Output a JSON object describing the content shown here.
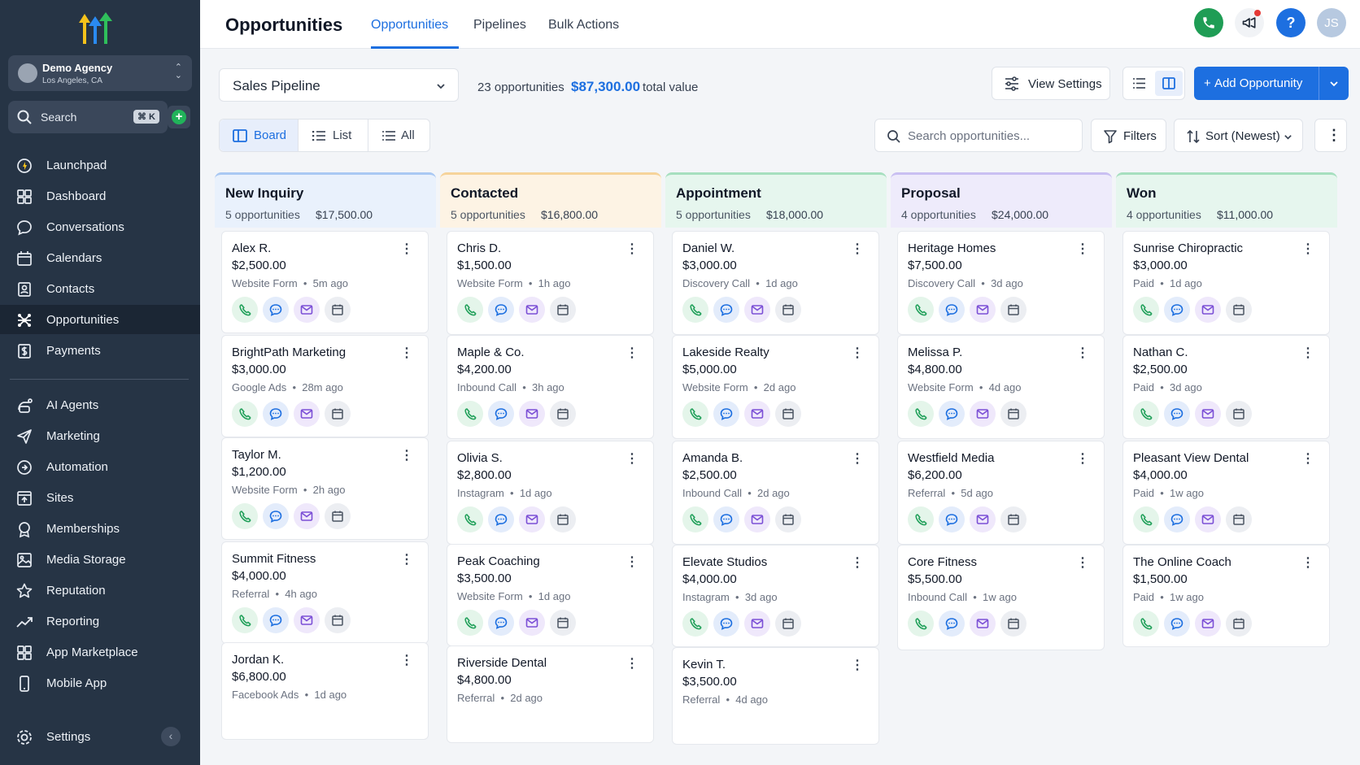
{
  "sidebar": {
    "account": {
      "name": "Demo Agency",
      "location": "Los Angeles, CA"
    },
    "search": {
      "label": "Search",
      "shortcut": "⌘ K"
    },
    "items": [
      {
        "label": "Launchpad",
        "icon": "launchpad-icon"
      },
      {
        "label": "Dashboard",
        "icon": "dashboard-icon"
      },
      {
        "label": "Conversations",
        "icon": "chat-icon"
      },
      {
        "label": "Calendars",
        "icon": "calendar-icon"
      },
      {
        "label": "Contacts",
        "icon": "contacts-icon"
      },
      {
        "label": "Opportunities",
        "icon": "opportunities-icon",
        "active": true
      },
      {
        "label": "Payments",
        "icon": "payments-icon"
      },
      {
        "label": "AI Agents",
        "icon": "ai-agents-icon"
      },
      {
        "label": "Marketing",
        "icon": "send-icon"
      },
      {
        "label": "Automation",
        "icon": "automation-icon"
      },
      {
        "label": "Sites",
        "icon": "sites-icon"
      },
      {
        "label": "Memberships",
        "icon": "memberships-icon"
      },
      {
        "label": "Media Storage",
        "icon": "media-icon"
      },
      {
        "label": "Reputation",
        "icon": "star-icon"
      },
      {
        "label": "Reporting",
        "icon": "trend-icon"
      },
      {
        "label": "App Marketplace",
        "icon": "apps-icon"
      },
      {
        "label": "Mobile App",
        "icon": "mobile-icon"
      }
    ],
    "settings": "Settings"
  },
  "header": {
    "title": "Opportunities",
    "tabs": [
      "Opportunities",
      "Pipelines",
      "Bulk Actions"
    ],
    "user_initials": "JS"
  },
  "toolbar": {
    "pipeline": "Sales Pipeline",
    "count": "23 opportunities",
    "total": "$87,300.00",
    "total_label": "total value",
    "view_settings": "View Settings",
    "add_opportunity": "Add Opportunity",
    "views": [
      "Board",
      "List",
      "All"
    ],
    "search_placeholder": "Search opportunities...",
    "filters": "Filters",
    "sort": "Sort (Newest)"
  },
  "colors": {
    "accent": "#1d6fe0",
    "sidebar": "#263445",
    "green": "#21a05a"
  },
  "columns": [
    {
      "title": "New Inquiry",
      "count": "5 opportunities",
      "value": "$17,500.00",
      "bg": "#e9f1fc",
      "bar": "#a9c8f3",
      "cards": [
        {
          "name": "Alex R.",
          "amount": "$2,500.00",
          "source": "Website Form",
          "time": "5m ago"
        },
        {
          "name": "BrightPath Marketing",
          "amount": "$3,000.00",
          "source": "Google Ads",
          "time": "28m ago"
        },
        {
          "name": "Taylor M.",
          "amount": "$1,200.00",
          "source": "Website Form",
          "time": "2h ago"
        },
        {
          "name": "Summit Fitness",
          "amount": "$4,000.00",
          "source": "Referral",
          "time": "4h ago"
        },
        {
          "name": "Jordan K.",
          "amount": "$6,800.00",
          "source": "Facebook Ads",
          "time": "1d ago"
        }
      ]
    },
    {
      "title": "Contacted",
      "count": "5 opportunities",
      "value": "$16,800.00",
      "bg": "#fdf3e4",
      "bar": "#f6d39a",
      "cards": [
        {
          "name": "Chris D.",
          "amount": "$1,500.00",
          "source": "Website Form",
          "time": "1h ago"
        },
        {
          "name": "Maple & Co.",
          "amount": "$4,200.00",
          "source": "Inbound Call",
          "time": "3h ago"
        },
        {
          "name": "Olivia S.",
          "amount": "$2,800.00",
          "source": "Instagram",
          "time": "1d ago"
        },
        {
          "name": "Peak Coaching",
          "amount": "$3,500.00",
          "source": "Website Form",
          "time": "1d ago"
        },
        {
          "name": "Riverside Dental",
          "amount": "$4,800.00",
          "source": "Referral",
          "time": "2d ago"
        }
      ]
    },
    {
      "title": "Appointment",
      "count": "5 opportunities",
      "value": "$18,000.00",
      "bg": "#e6f6ee",
      "bar": "#a6dfbf",
      "cards": [
        {
          "name": "Daniel W.",
          "amount": "$3,000.00",
          "source": "Discovery Call",
          "time": "1d ago"
        },
        {
          "name": "Lakeside Realty",
          "amount": "$5,000.00",
          "source": "Website Form",
          "time": "2d ago"
        },
        {
          "name": "Amanda B.",
          "amount": "$2,500.00",
          "source": "Inbound Call",
          "time": "2d ago"
        },
        {
          "name": "Elevate Studios",
          "amount": "$4,000.00",
          "source": "Instagram",
          "time": "3d ago"
        },
        {
          "name": "Kevin T.",
          "amount": "$3,500.00",
          "source": "Referral",
          "time": "4d ago"
        }
      ]
    },
    {
      "title": "Proposal",
      "count": "4 opportunities",
      "value": "$24,000.00",
      "bg": "#eeebfb",
      "bar": "#c9bff2",
      "cards": [
        {
          "name": "Heritage Homes",
          "amount": "$7,500.00",
          "source": "Discovery Call",
          "time": "3d ago"
        },
        {
          "name": "Melissa P.",
          "amount": "$4,800.00",
          "source": "Website Form",
          "time": "4d ago"
        },
        {
          "name": "Westfield Media",
          "amount": "$6,200.00",
          "source": "Referral",
          "time": "5d ago"
        },
        {
          "name": "Core Fitness",
          "amount": "$5,500.00",
          "source": "Inbound Call",
          "time": "1w ago"
        }
      ]
    },
    {
      "title": "Won",
      "count": "4 opportunities",
      "value": "$11,000.00",
      "bg": "#e6f6ee",
      "bar": "#a6dfbf",
      "cards": [
        {
          "name": "Sunrise Chiropractic",
          "amount": "$3,000.00",
          "source": "Paid",
          "time": "1d ago"
        },
        {
          "name": "Nathan C.",
          "amount": "$2,500.00",
          "source": "Paid",
          "time": "3d ago"
        },
        {
          "name": "Pleasant View Dental",
          "amount": "$4,000.00",
          "source": "Paid",
          "time": "1w ago"
        },
        {
          "name": "The Online Coach",
          "amount": "$1,500.00",
          "source": "Paid",
          "time": "1w ago"
        }
      ]
    }
  ]
}
